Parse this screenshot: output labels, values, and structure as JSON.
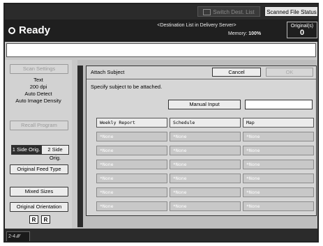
{
  "topbar": {
    "switch_dest_list": "Switch Dest. List",
    "scanned_file_status": "Scanned File Status"
  },
  "status": {
    "ready": "Ready",
    "destination_list": "<Destination List in Delivery Server>",
    "memory_label": "Memory:",
    "memory_value": "100%",
    "originals_label": "Original(s)",
    "originals_value": "0"
  },
  "left_panel": {
    "scan_settings": "Scan Settings",
    "settings": [
      "Text",
      "200 dpi",
      "Auto Detect",
      "Auto Image Density"
    ],
    "recall_program": "Recall Program",
    "one_side_orig": "1 Side Orig.",
    "two_side_orig": "2 Side Orig.",
    "original_feed_type": "Original Feed Type",
    "mixed_sizes": "Mixed Sizes",
    "original_orientation": "Original Orientation",
    "orientation_icons": [
      "R",
      "R"
    ]
  },
  "dialog": {
    "title": "Attach Subject",
    "cancel": "Cancel",
    "ok": "OK",
    "message": "Specify subject to be attached.",
    "manual_input": "Manual Input",
    "manual_value": "",
    "columns": [
      "Weekly Report",
      "Schedule",
      "Map"
    ],
    "rows": [
      [
        "*None",
        "*None",
        "*None"
      ],
      [
        "*None",
        "*None",
        "*None"
      ],
      [
        "*None",
        "*None",
        "*None"
      ],
      [
        "*None",
        "*None",
        "*None"
      ],
      [
        "*None",
        "*None",
        "*None"
      ],
      [
        "*None",
        "*None",
        "*None"
      ]
    ]
  },
  "bottom": {
    "tab_label": "2-4"
  }
}
